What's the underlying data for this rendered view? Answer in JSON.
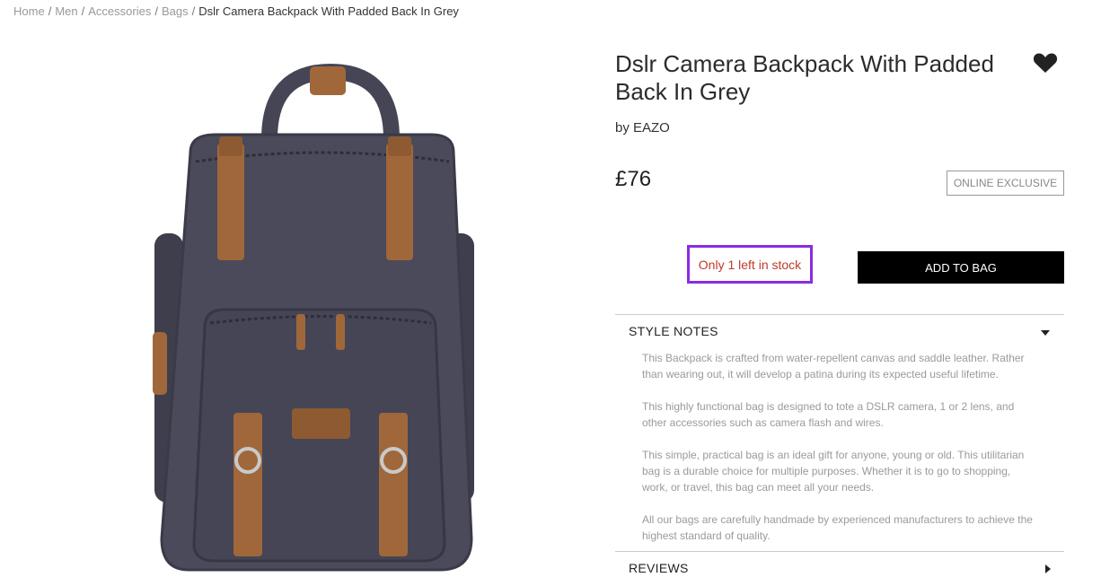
{
  "breadcrumb": {
    "items": [
      "Home",
      "Men",
      "Accessories",
      "Bags"
    ],
    "current": "Dslr Camera Backpack With Padded Back In Grey",
    "separator": "/"
  },
  "product": {
    "title": "Dslr Camera Backpack With Padded Back In Grey",
    "brand": "by EAZO",
    "price": "£76",
    "badge": "ONLINE EXCLUSIVE",
    "stock": "Only 1 left in stock",
    "add_to_bag": "ADD TO BAG",
    "image_alt": "Grey canvas camera backpack with brown leather straps"
  },
  "icons": {
    "wishlist": "heart-icon",
    "expand_open": "caret-down-icon",
    "expand_closed": "caret-right-icon"
  },
  "style_notes": {
    "label": "STYLE NOTES",
    "paragraphs": [
      "This Backpack is crafted from water-repellent canvas and saddle leather. Rather than wearing out, it will develop a patina during its expected useful lifetime.",
      "This highly functional bag is designed to tote a DSLR camera, 1 or 2 lens, and other accessories such as camera flash and wires.",
      "This simple, practical bag is an ideal gift for anyone, young or old. This utilitarian bag is a durable choice for multiple purposes. Whether it is to go to shopping, work, or travel, this bag can meet all your needs.",
      "All our bags are carefully handmade by experienced manufacturers to achieve the highest standard of quality."
    ]
  },
  "reviews": {
    "label": "REVIEWS"
  },
  "colors": {
    "stock_text": "#c0392b",
    "stock_border": "#8a2be2",
    "button_bg": "#000000",
    "bag_canvas": "#4a4a5a",
    "bag_leather": "#a0673a"
  }
}
